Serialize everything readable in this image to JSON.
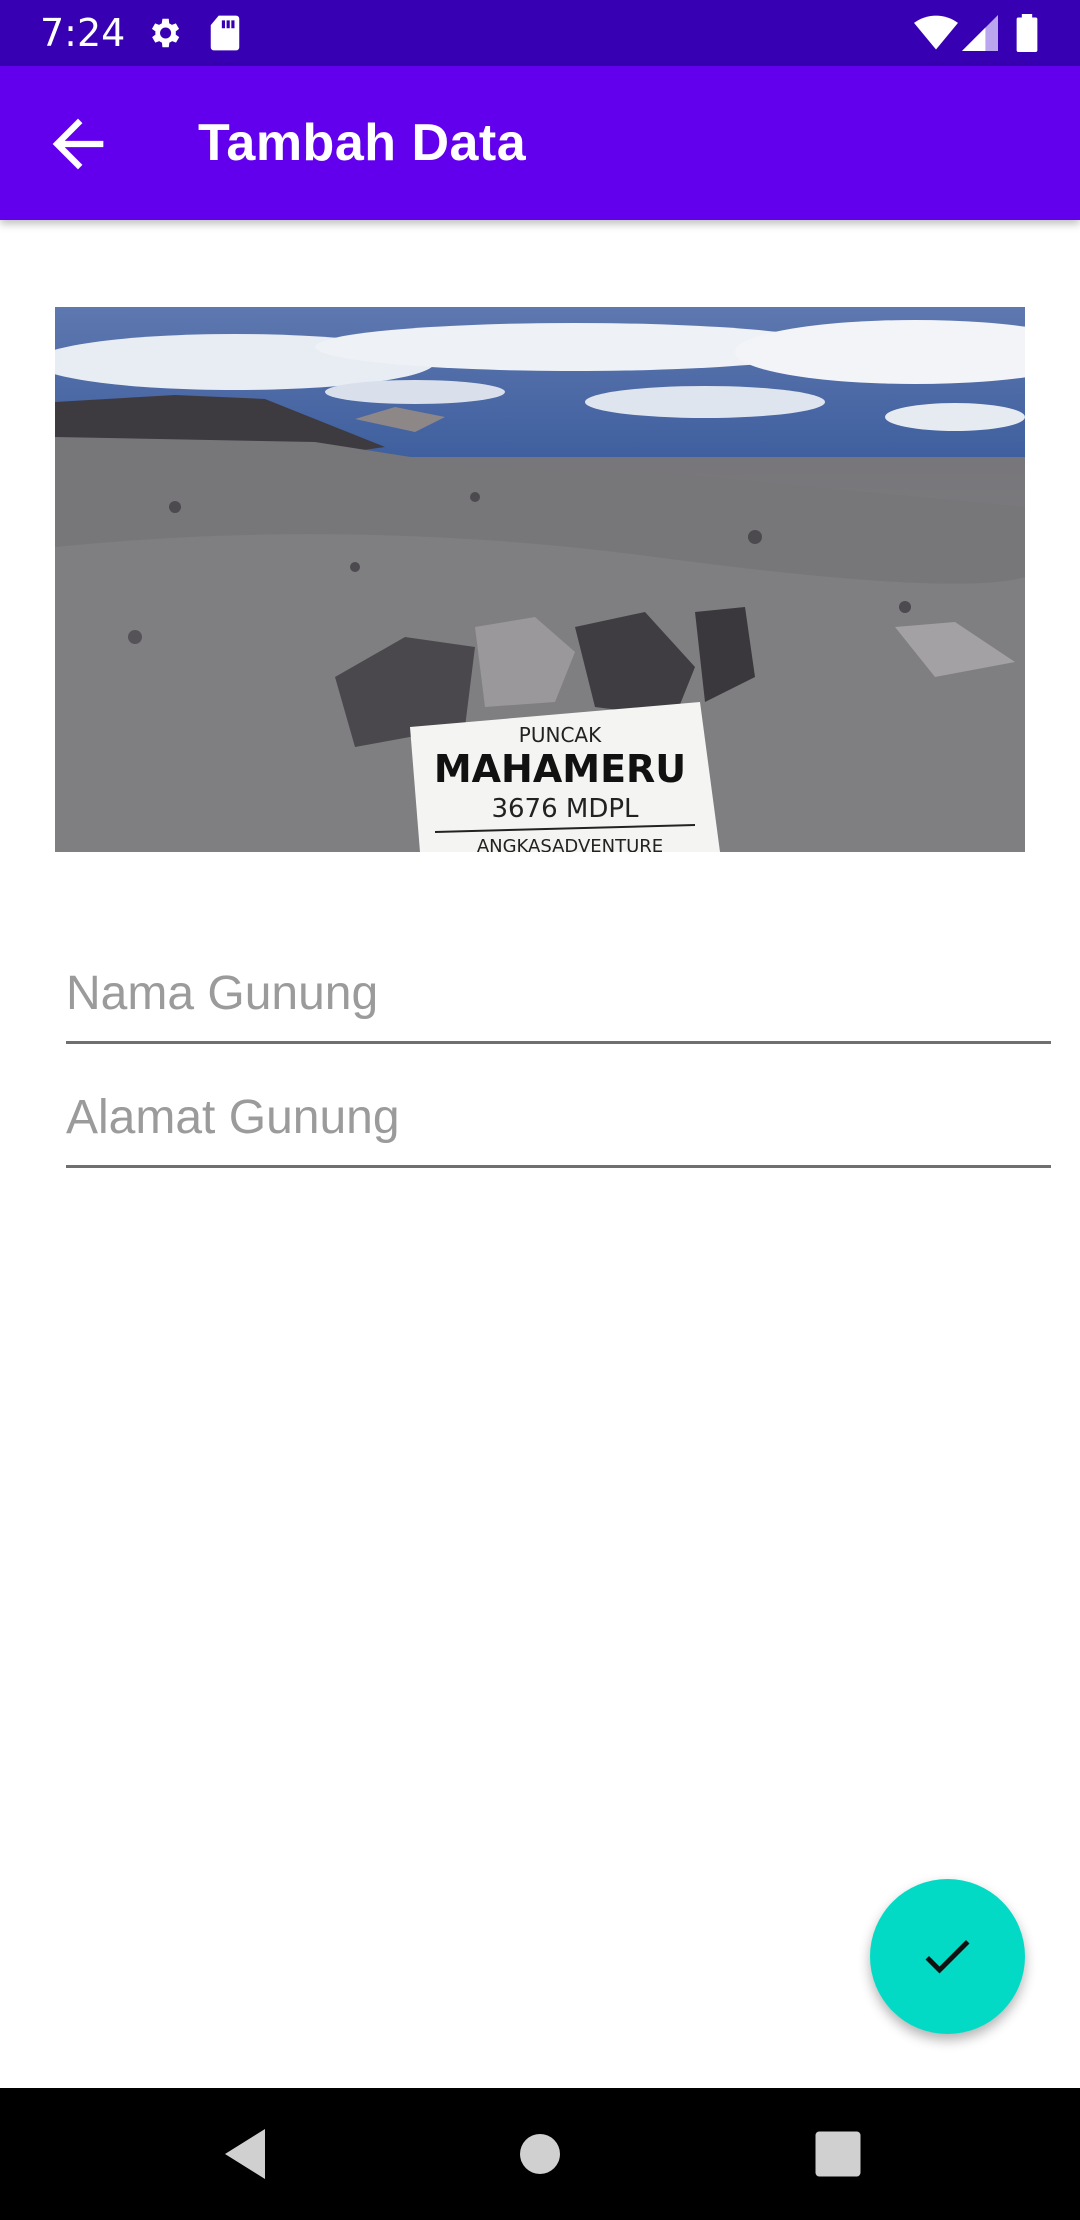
{
  "status_bar": {
    "time": "7:24",
    "icons": [
      "gear-icon",
      "sd-card-icon",
      "wifi-icon",
      "signal-icon",
      "battery-icon"
    ]
  },
  "app_bar": {
    "title": "Tambah Data",
    "back_icon": "arrow-back-icon",
    "color": "#6200EE"
  },
  "photo": {
    "sign_lines": [
      "PUNCAK",
      "MAHAMERU",
      "3676 MDPL",
      "ANGKASADVENTURE"
    ]
  },
  "form": {
    "nama_placeholder": "Nama Gunung",
    "alamat_placeholder": "Alamat Gunung"
  },
  "fab": {
    "icon": "check-icon",
    "color": "#03DAC5"
  },
  "nav_bar": {
    "icons": [
      "nav-back-icon",
      "nav-home-icon",
      "nav-recents-icon"
    ]
  }
}
